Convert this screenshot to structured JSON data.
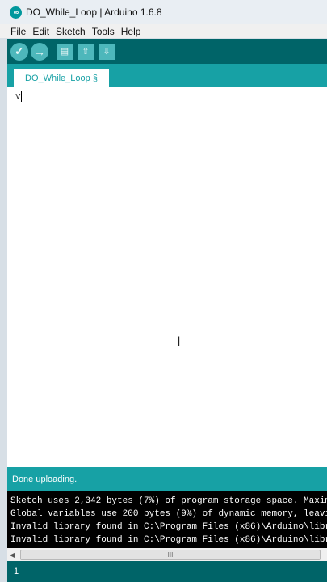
{
  "window": {
    "title": "DO_While_Loop | Arduino 1.6.8",
    "logo_glyph": "∞"
  },
  "menu": [
    "File",
    "Edit",
    "Sketch",
    "Tools",
    "Help"
  ],
  "toolbar": {
    "verify_icon": "✓",
    "upload_icon": "→",
    "new_icon": "▤",
    "open_icon": "⇧",
    "save_icon": "⇩"
  },
  "tab": {
    "label": "DO_While_Loop §"
  },
  "editor": {
    "text": "v"
  },
  "status": {
    "message": "Done uploading."
  },
  "console": {
    "lines": [
      "Sketch uses 2,342 bytes (7%) of program storage space. Maxim",
      "Global variables use 200 bytes (9%) of dynamic memory, leavi",
      "Invalid library found in C:\\Program Files (x86)\\Arduino\\libr",
      "Invalid library found in C:\\Program Files (x86)\\Arduino\\libr"
    ]
  },
  "scrollbar": {
    "grip": "III"
  },
  "footer": {
    "line_number": "1"
  },
  "colors": {
    "toolbar_bg": "#006468",
    "tab_bg": "#17a1a5",
    "accent": "#4db7bb"
  }
}
